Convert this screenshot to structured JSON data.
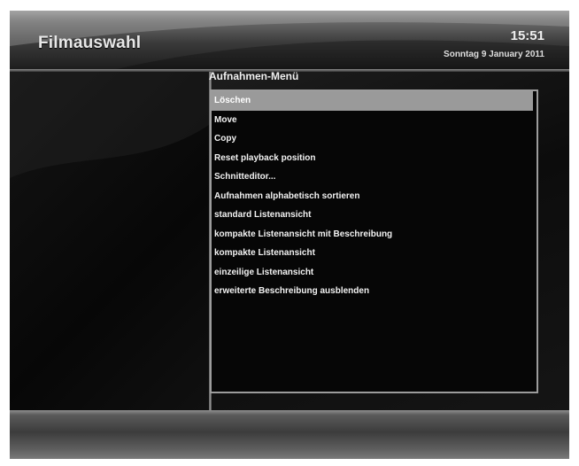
{
  "header": {
    "title": "Filmauswahl",
    "clock": "15:51",
    "date": "Sonntag 9 January 2011"
  },
  "menu": {
    "title": "Aufnahmen-Menü",
    "selected_index": 0,
    "items": [
      {
        "label": "Löschen"
      },
      {
        "label": "Move"
      },
      {
        "label": "Copy"
      },
      {
        "label": "Reset playback position"
      },
      {
        "label": "Schnitteditor..."
      },
      {
        "label": "Aufnahmen alphabetisch sortieren"
      },
      {
        "label": "standard Listenansicht"
      },
      {
        "label": "kompakte Listenansicht mit Beschreibung"
      },
      {
        "label": "kompakte Listenansicht"
      },
      {
        "label": "einzeilige Listenansicht"
      },
      {
        "label": "erweiterte Beschreibung ausblenden"
      }
    ]
  },
  "colors": {
    "selection": "#9a9a9a",
    "menu_border": "#9c9c9c",
    "text": "#f2f2f2"
  }
}
